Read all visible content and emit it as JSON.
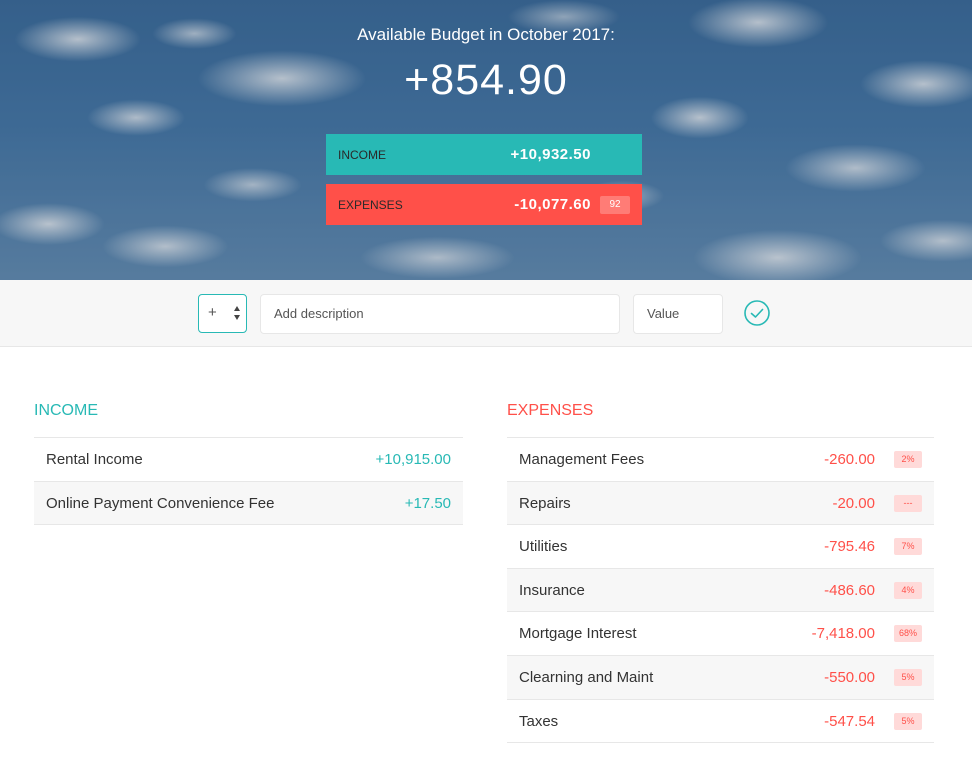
{
  "budget": {
    "title": "Available Budget in October 2017:",
    "value": "+854.90",
    "income": {
      "label": "Income",
      "value": "+10,932.50"
    },
    "expenses": {
      "label": "Expenses",
      "value": "-10,077.60",
      "percentage": "92"
    }
  },
  "add": {
    "type_value": "+",
    "description_placeholder": "Add description",
    "value_placeholder": "Value"
  },
  "income": {
    "title": "Income",
    "items": [
      {
        "description": "Rental Income",
        "value": "+10,915.00"
      },
      {
        "description": "Online Payment Convenience Fee",
        "value": "+17.50"
      }
    ]
  },
  "expenses": {
    "title": "Expenses",
    "items": [
      {
        "description": "Management Fees",
        "value": "-260.00",
        "percentage": "2%"
      },
      {
        "description": "Repairs",
        "value": "-20.00",
        "percentage": "---"
      },
      {
        "description": "Utilities",
        "value": "-795.46",
        "percentage": "7%"
      },
      {
        "description": "Insurance",
        "value": "-486.60",
        "percentage": "4%"
      },
      {
        "description": "Mortgage Interest",
        "value": "-7,418.00",
        "percentage": "68%"
      },
      {
        "description": "Clearning and Maint",
        "value": "-550.00",
        "percentage": "5%"
      },
      {
        "description": "Taxes",
        "value": "-547.54",
        "percentage": "5%"
      }
    ]
  },
  "colors": {
    "income": "#28b9b5",
    "expenses": "#ff5049"
  },
  "icons": {
    "add_button": "check-circle-icon",
    "type_select": "select-arrows-icon"
  }
}
